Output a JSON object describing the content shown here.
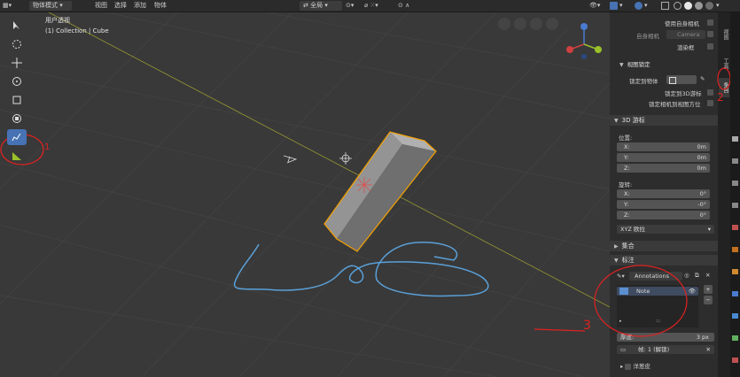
{
  "header": {
    "mode": "物体模式",
    "menus": [
      "视图",
      "选择",
      "添加",
      "物体"
    ],
    "orientation": "全局"
  },
  "viewport": {
    "perspective": "用户透视",
    "collection": "(1) Collection | Cube"
  },
  "tabs": [
    "视图",
    "工具",
    "条目"
  ],
  "view_panel": {
    "use_local_camera": "使用自身相机",
    "local_camera": "自身相机",
    "camera_value": "Camera",
    "render_region": "渲染框",
    "view_lock_title": "视图锁定",
    "lock_to_object": "锁定到物体",
    "lock_to_3d_cursor": "锁定到3D游标",
    "lock_camera_to_view": "锁定相机到视图方位"
  },
  "cursor_panel": {
    "title": "3D 游标",
    "location": "位置:",
    "loc": [
      {
        "axis": "X:",
        "value": "0m"
      },
      {
        "axis": "Y:",
        "value": "0m"
      },
      {
        "axis": "Z:",
        "value": "0m"
      }
    ],
    "rotation": "旋转:",
    "rot": [
      {
        "axis": "X:",
        "value": "0°"
      },
      {
        "axis": "Y:",
        "value": "-0°"
      },
      {
        "axis": "Z:",
        "value": "0°"
      }
    ],
    "rotation_mode": "XYZ 欧拉"
  },
  "collection_panel": {
    "title": "集合"
  },
  "annotation_panel": {
    "title": "标注",
    "datablock": "Annotations",
    "layer": "Note",
    "thickness_label": "厚度:",
    "thickness_value": "3 px",
    "frame_label": "帧: 1 (解锁)",
    "onion_skin": "洋葱皮"
  },
  "handwritten_labels": [
    "1",
    "2",
    "3"
  ],
  "colors": {
    "accent": "#4772b3",
    "annotation_stroke": "#5aa0d8",
    "annotation_swatch": "#5b8fd0",
    "selection_outline": "#f5a100",
    "red_marker": "#e02222",
    "x_axis": "#d04040",
    "y_axis": "#9ac02a"
  }
}
